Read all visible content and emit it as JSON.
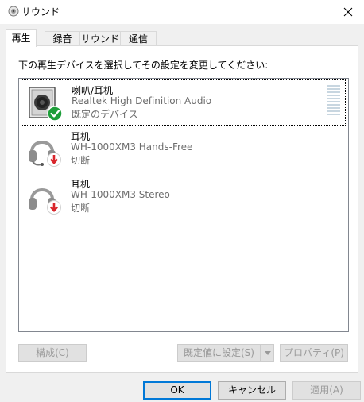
{
  "window": {
    "title": "サウンド"
  },
  "tabs": [
    "再生",
    "録音",
    "サウンド",
    "通信"
  ],
  "instruction": "下の再生デバイスを選択してその設定を変更してください:",
  "devices": [
    {
      "name": "喇叭/耳机",
      "description": "Realtek High Definition Audio",
      "status": "既定のデバイス",
      "icon": "speaker-icon",
      "status_icon": "check-icon",
      "selected": true
    },
    {
      "name": "耳机",
      "description": "WH-1000XM3 Hands-Free",
      "status": "切断",
      "icon": "headset-icon",
      "status_icon": "disconnected-arrow-icon",
      "selected": false
    },
    {
      "name": "耳机",
      "description": "WH-1000XM3 Stereo",
      "status": "切断",
      "icon": "headphones-icon",
      "status_icon": "disconnected-arrow-icon",
      "selected": false
    }
  ],
  "panel_buttons": {
    "configure": "構成(C)",
    "set_default": "既定値に設定(S)",
    "properties": "プロパティ(P)"
  },
  "dialog_buttons": {
    "ok": "OK",
    "cancel": "キャンセル",
    "apply": "適用(A)"
  },
  "colors": {
    "accent": "#0078d7",
    "check_green": "#1e9e3a",
    "disconnect_red": "#d9262c"
  }
}
